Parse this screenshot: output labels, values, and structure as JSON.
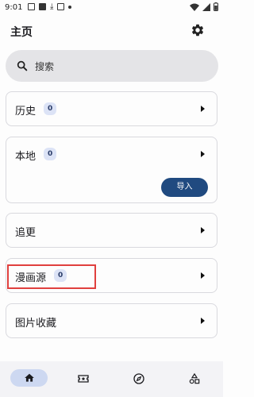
{
  "status": {
    "time": "9:01"
  },
  "header": {
    "title": "主页"
  },
  "search": {
    "placeholder": "搜索"
  },
  "cards": {
    "history": {
      "label": "历史",
      "count": "0"
    },
    "local": {
      "label": "本地",
      "count": "0",
      "import_label": "导入"
    },
    "follow": {
      "label": "追更"
    },
    "source": {
      "label": "漫画源",
      "count": "0"
    },
    "favorites": {
      "label": "图片收藏"
    }
  },
  "colors": {
    "accent": "#204a80",
    "badge_bg": "#dce3f6",
    "highlight": "#e0403e"
  },
  "nav": [
    "home-icon",
    "ticket-star-icon",
    "explore-icon",
    "categories-icon"
  ]
}
